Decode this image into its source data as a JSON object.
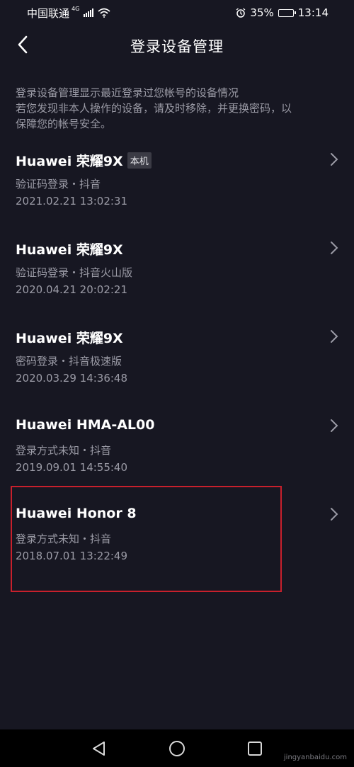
{
  "status_bar": {
    "carrier": "中国联通",
    "network": "4G",
    "battery": "35%",
    "battery_level": 0.35,
    "time": "13:14"
  },
  "header": {
    "title": "登录设备管理"
  },
  "description": {
    "line1": "登录设备管理显示最近登录过您帐号的设备情况",
    "line2": "若您发现非本人操作的设备，请及时移除，并更换密码，以",
    "line3": "保障您的帐号安全。"
  },
  "devices": [
    {
      "name": "Huawei 荣耀9X",
      "tag": "本机",
      "method": "验证码登录・抖音",
      "time": "2021.02.21 13:02:31"
    },
    {
      "name": "Huawei 荣耀9X",
      "method": "验证码登录・抖音火山版",
      "time": "2020.04.21 20:02:21"
    },
    {
      "name": "Huawei 荣耀9X",
      "method": "密码登录・抖音极速版",
      "time": "2020.03.29 14:36:48"
    },
    {
      "name": "Huawei HMA-AL00",
      "method": "登录方式未知・抖音",
      "time": "2019.09.01 14:55:40"
    },
    {
      "name": "Huawei Honor 8",
      "method": "登录方式未知・抖音",
      "time": "2018.07.01 13:22:49"
    }
  ],
  "colors": {
    "background": "#171722",
    "secondary_text": "#9b9ba6",
    "highlight": "#c8202c"
  },
  "watermark": "jingyanbaidu.com"
}
